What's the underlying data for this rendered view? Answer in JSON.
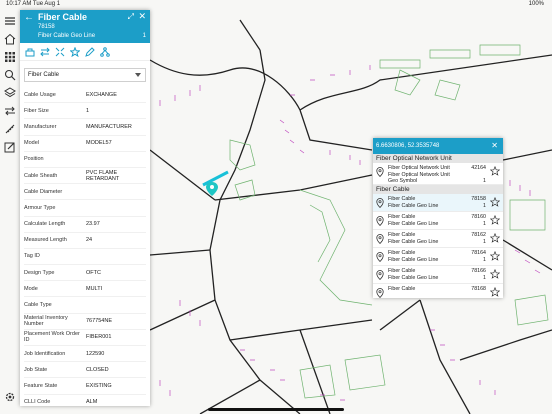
{
  "status": {
    "time": "10:17 AM   Tue Aug 1",
    "battery": "100%"
  },
  "panel": {
    "title": "Fiber Cable",
    "feature_id": "78158",
    "subtitle": "Fiber Cable Geo Line",
    "count": "1",
    "dropdown_value": "Fiber Cable",
    "attributes": [
      {
        "k": "Cable Usage",
        "v": "EXCHANGE"
      },
      {
        "k": "Fiber Size",
        "v": "1"
      },
      {
        "k": "Manufacturer",
        "v": "MANUFACTURER"
      },
      {
        "k": "Model",
        "v": "MODEL57"
      },
      {
        "k": "Position",
        "v": ""
      },
      {
        "k": "Cable Sheath",
        "v": "PVC FLAME RETARDANT"
      },
      {
        "k": "Cable Diameter",
        "v": ""
      },
      {
        "k": "Armour Type",
        "v": ""
      },
      {
        "k": "Calculate Length",
        "v": "23.97"
      },
      {
        "k": "Measured Length",
        "v": "24"
      },
      {
        "k": "Tag ID",
        "v": ""
      },
      {
        "k": "Design Type",
        "v": "OFTC"
      },
      {
        "k": "Mode",
        "v": "MULTI"
      },
      {
        "k": "Cable Type",
        "v": ""
      },
      {
        "k": "Material Inventory Number",
        "v": "767754NE"
      },
      {
        "k": "Placement Work Order ID",
        "v": "FIBER001"
      },
      {
        "k": "Job Identification",
        "v": "122590"
      },
      {
        "k": "Job State",
        "v": "CLOSED"
      },
      {
        "k": "Feature State",
        "v": "EXISTING"
      },
      {
        "k": "CLLI Code",
        "v": "ALM"
      }
    ]
  },
  "popup": {
    "coords": "6.6630806, 52.3535748",
    "section_network": "Fiber Optical Network Unit",
    "network_item": {
      "l1": "Fiber Optical Network Unit",
      "l2": "Fiber Optical Network Unit",
      "l3": "Geo Symbol",
      "id": "42164",
      "n": "1"
    },
    "section_cable": "Fiber Cable",
    "cable_items": [
      {
        "l1": "Fiber Cable",
        "l2": "Fiber Cable Geo Line",
        "id": "78158",
        "n": "1"
      },
      {
        "l1": "Fiber Cable",
        "l2": "Fiber Cable Geo Line",
        "id": "78160",
        "n": "1"
      },
      {
        "l1": "Fiber Cable",
        "l2": "Fiber Cable Geo Line",
        "id": "78162",
        "n": "1"
      },
      {
        "l1": "Fiber Cable",
        "l2": "Fiber Cable Geo Line",
        "id": "78164",
        "n": "1"
      },
      {
        "l1": "Fiber Cable",
        "l2": "Fiber Cable Geo Line",
        "id": "78166",
        "n": "1"
      },
      {
        "l1": "Fiber Cable",
        "l2": "",
        "id": "78168",
        "n": ""
      }
    ]
  },
  "colors": {
    "accent": "#1c9ec8",
    "road": "#222222",
    "building": "#6fb36f",
    "fiber": "#c04dc0"
  }
}
